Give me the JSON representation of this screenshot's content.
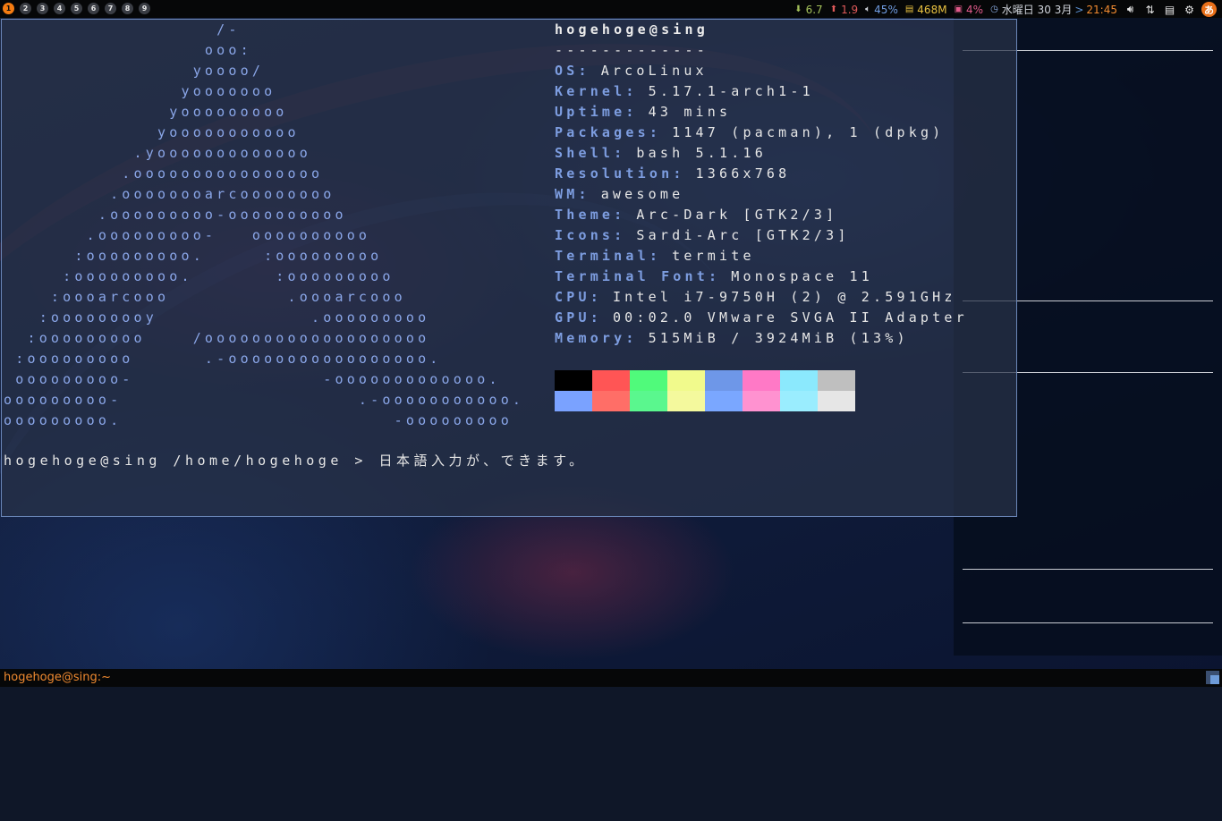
{
  "topbar": {
    "tags": [
      "1",
      "2",
      "3",
      "4",
      "5",
      "6",
      "7",
      "8",
      "9"
    ],
    "widgets": {
      "net_down": {
        "icon": "down-arrow-icon",
        "value": "6.7",
        "color": "#a4c15a"
      },
      "net_up": {
        "icon": "up-arrow-icon",
        "value": "1.9",
        "color": "#e05a5a"
      },
      "volume": {
        "icon": "volume-icon",
        "value": "45%",
        "color": "#6f9be0"
      },
      "memory": {
        "icon": "memory-icon",
        "value": "468M",
        "color": "#e8c040"
      },
      "cpu": {
        "icon": "cpu-icon",
        "value": "4%",
        "color": "#e05a8a"
      },
      "date": {
        "icon": "clock-icon",
        "value": "水曜日 30 3月",
        "color": "#cfd3da"
      },
      "sep": ">",
      "time": {
        "value": "21:45",
        "color": "#f08a30"
      }
    },
    "ime_label": "あ"
  },
  "terminal": {
    "logo_lines": [
      "                  /-",
      "                 ooo:",
      "                yoooo/",
      "               yooooooo",
      "              yooooooooo",
      "             yooooooooooo",
      "           .yooooooooooooo",
      "          .oooooooooooooooo",
      "         .oooooooarcoooooooo",
      "        .ooooooooo-oooooooooo",
      "       .ooooooooo-   oooooooooo",
      "      :ooooooooo.     :ooooooooo",
      "     :ooooooooo.       :ooooooooo",
      "    :oooarcooo          .oooarcooo",
      "   :ooooooooy             .ooooooooo",
      "  :ooooooooo    /ooooooooooooooooooo",
      " :ooooooooo      .-ooooooooooooooooo.",
      " ooooooooo-                -ooooooooooooo.",
      "ooooooooo-                    .-ooooooooooo.",
      "ooooooooo.                       -ooooooooo"
    ],
    "info_title": "hogehoge@sing",
    "info_underline": "-------------",
    "info": [
      {
        "key": "OS",
        "value": "ArcoLinux"
      },
      {
        "key": "Kernel",
        "value": "5.17.1-arch1-1"
      },
      {
        "key": "Uptime",
        "value": "43 mins"
      },
      {
        "key": "Packages",
        "value": "1147 (pacman), 1 (dpkg)"
      },
      {
        "key": "Shell",
        "value": "bash 5.1.16"
      },
      {
        "key": "Resolution",
        "value": "1366x768"
      },
      {
        "key": "WM",
        "value": "awesome"
      },
      {
        "key": "Theme",
        "value": "Arc-Dark [GTK2/3]"
      },
      {
        "key": "Icons",
        "value": "Sardi-Arc [GTK2/3]"
      },
      {
        "key": "Terminal",
        "value": "termite"
      },
      {
        "key": "Terminal Font",
        "value": "Monospace 11"
      },
      {
        "key": "CPU",
        "value": "Intel i7-9750H (2) @ 2.591GHz"
      },
      {
        "key": "GPU",
        "value": "00:02.0 VMware SVGA II Adapter"
      },
      {
        "key": "Memory",
        "value": "515MiB / 3924MiB (13%)"
      }
    ],
    "palette_top": [
      "#000000",
      "#ff5555",
      "#50fa7b",
      "#f1fa8c",
      "#6e97e8",
      "#ff79c6",
      "#8be9fd",
      "#bfbfbf"
    ],
    "palette_bottom": [
      "#7aa2ff",
      "#ff6e67",
      "#5af78e",
      "#f4f99d",
      "#7aa7ff",
      "#ff92d0",
      "#9aedfe",
      "#e6e6e6"
    ],
    "prompt": "hogehoge@sing /home/hogehoge > 日本語入力が、できます。"
  },
  "bottombar": {
    "task_title": "hogehoge@sing:~"
  }
}
